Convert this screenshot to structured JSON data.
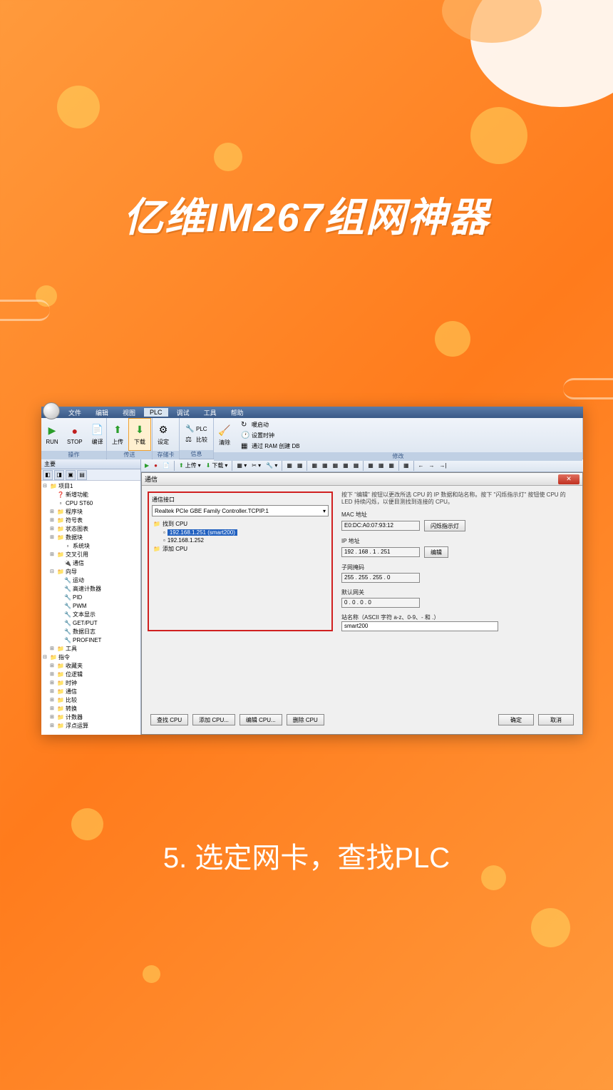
{
  "overlay": {
    "title": "亿维IM267组网神器",
    "caption": "5.  选定网卡，查找PLC"
  },
  "menu": {
    "items": [
      "文件",
      "编辑",
      "视图",
      "PLC",
      "调试",
      "工具",
      "帮助"
    ],
    "active_index": 3
  },
  "ribbon": {
    "group_operate": "操作",
    "group_transfer": "传送",
    "group_storage": "存储卡",
    "group_info": "信息",
    "group_modify": "修改",
    "run": "RUN",
    "stop": "STOP",
    "compile": "编译",
    "upload": "上传",
    "download": "下载",
    "settings": "设定",
    "plc": "PLC",
    "compare": "比较",
    "clear": "清除",
    "warm_start": "暖启动",
    "set_clock": "设置时钟",
    "create_db": "通过 RAM 创建 DB"
  },
  "left_panel": {
    "header": "主要"
  },
  "toolbar": {
    "upload": "上传",
    "download": "下载"
  },
  "tree": {
    "root": "项目1",
    "new_feature": "新增功能",
    "cpu": "CPU ST60",
    "program_block": "程序块",
    "symbol_table": "符号表",
    "status_chart": "状态图表",
    "data_block": "数据块",
    "system_block": "系统块",
    "cross_ref": "交叉引用",
    "comm": "通信",
    "wizard": "向导",
    "motion": "运动",
    "hsc": "高速计数器",
    "pid": "PID",
    "pwm": "PWM",
    "text_display": "文本显示",
    "get_put": "GET/PUT",
    "data_log": "数据日志",
    "profinet": "PROFINET",
    "tools": "工具",
    "instructions": "指令",
    "favorites": "收藏夹",
    "bit_logic": "位逻辑",
    "clock": "时钟",
    "comm2": "通信",
    "compare_ins": "比较",
    "convert": "转换",
    "counters": "计数器",
    "float": "浮点运算"
  },
  "dialog": {
    "title": "通信",
    "comm_interface": "通信接口",
    "interface_value": "Realtek PCIe GBE Family Controller.TCPIP.1",
    "found_cpu": "找到 CPU",
    "cpu1": "192.168.1.251 (smart200)",
    "cpu2": "192.168.1.252",
    "add_cpu": "添加 CPU",
    "help_text": "按下 \"编辑\" 按钮以更改所选 CPU 的 IP 数据和站名称。按下 \"闪烁指示灯\" 按钮使 CPU 的 LED 持续闪烁，以便目测找到连接的 CPU。",
    "mac_label": "MAC 地址",
    "mac_value": "E0:DC:A0:07:93:12",
    "flash_led": "闪烁指示灯",
    "ip_label": "IP 地址",
    "ip_value": "192 . 168 .  1  . 251",
    "edit": "编辑",
    "subnet_label": "子网掩码",
    "subnet_value": "255 . 255 . 255 .  0",
    "gateway_label": "默认网关",
    "gateway_value": "0  .  0  .  0  .  0",
    "station_label": "站名称（ASCII 字符 a-z、0-9、- 和 .）",
    "station_value": "smart200",
    "find_cpu": "查找 CPU",
    "add_cpu_btn": "添加 CPU...",
    "edit_cpu": "编辑 CPU...",
    "delete_cpu": "删除 CPU",
    "ok": "确定",
    "cancel": "取消"
  }
}
